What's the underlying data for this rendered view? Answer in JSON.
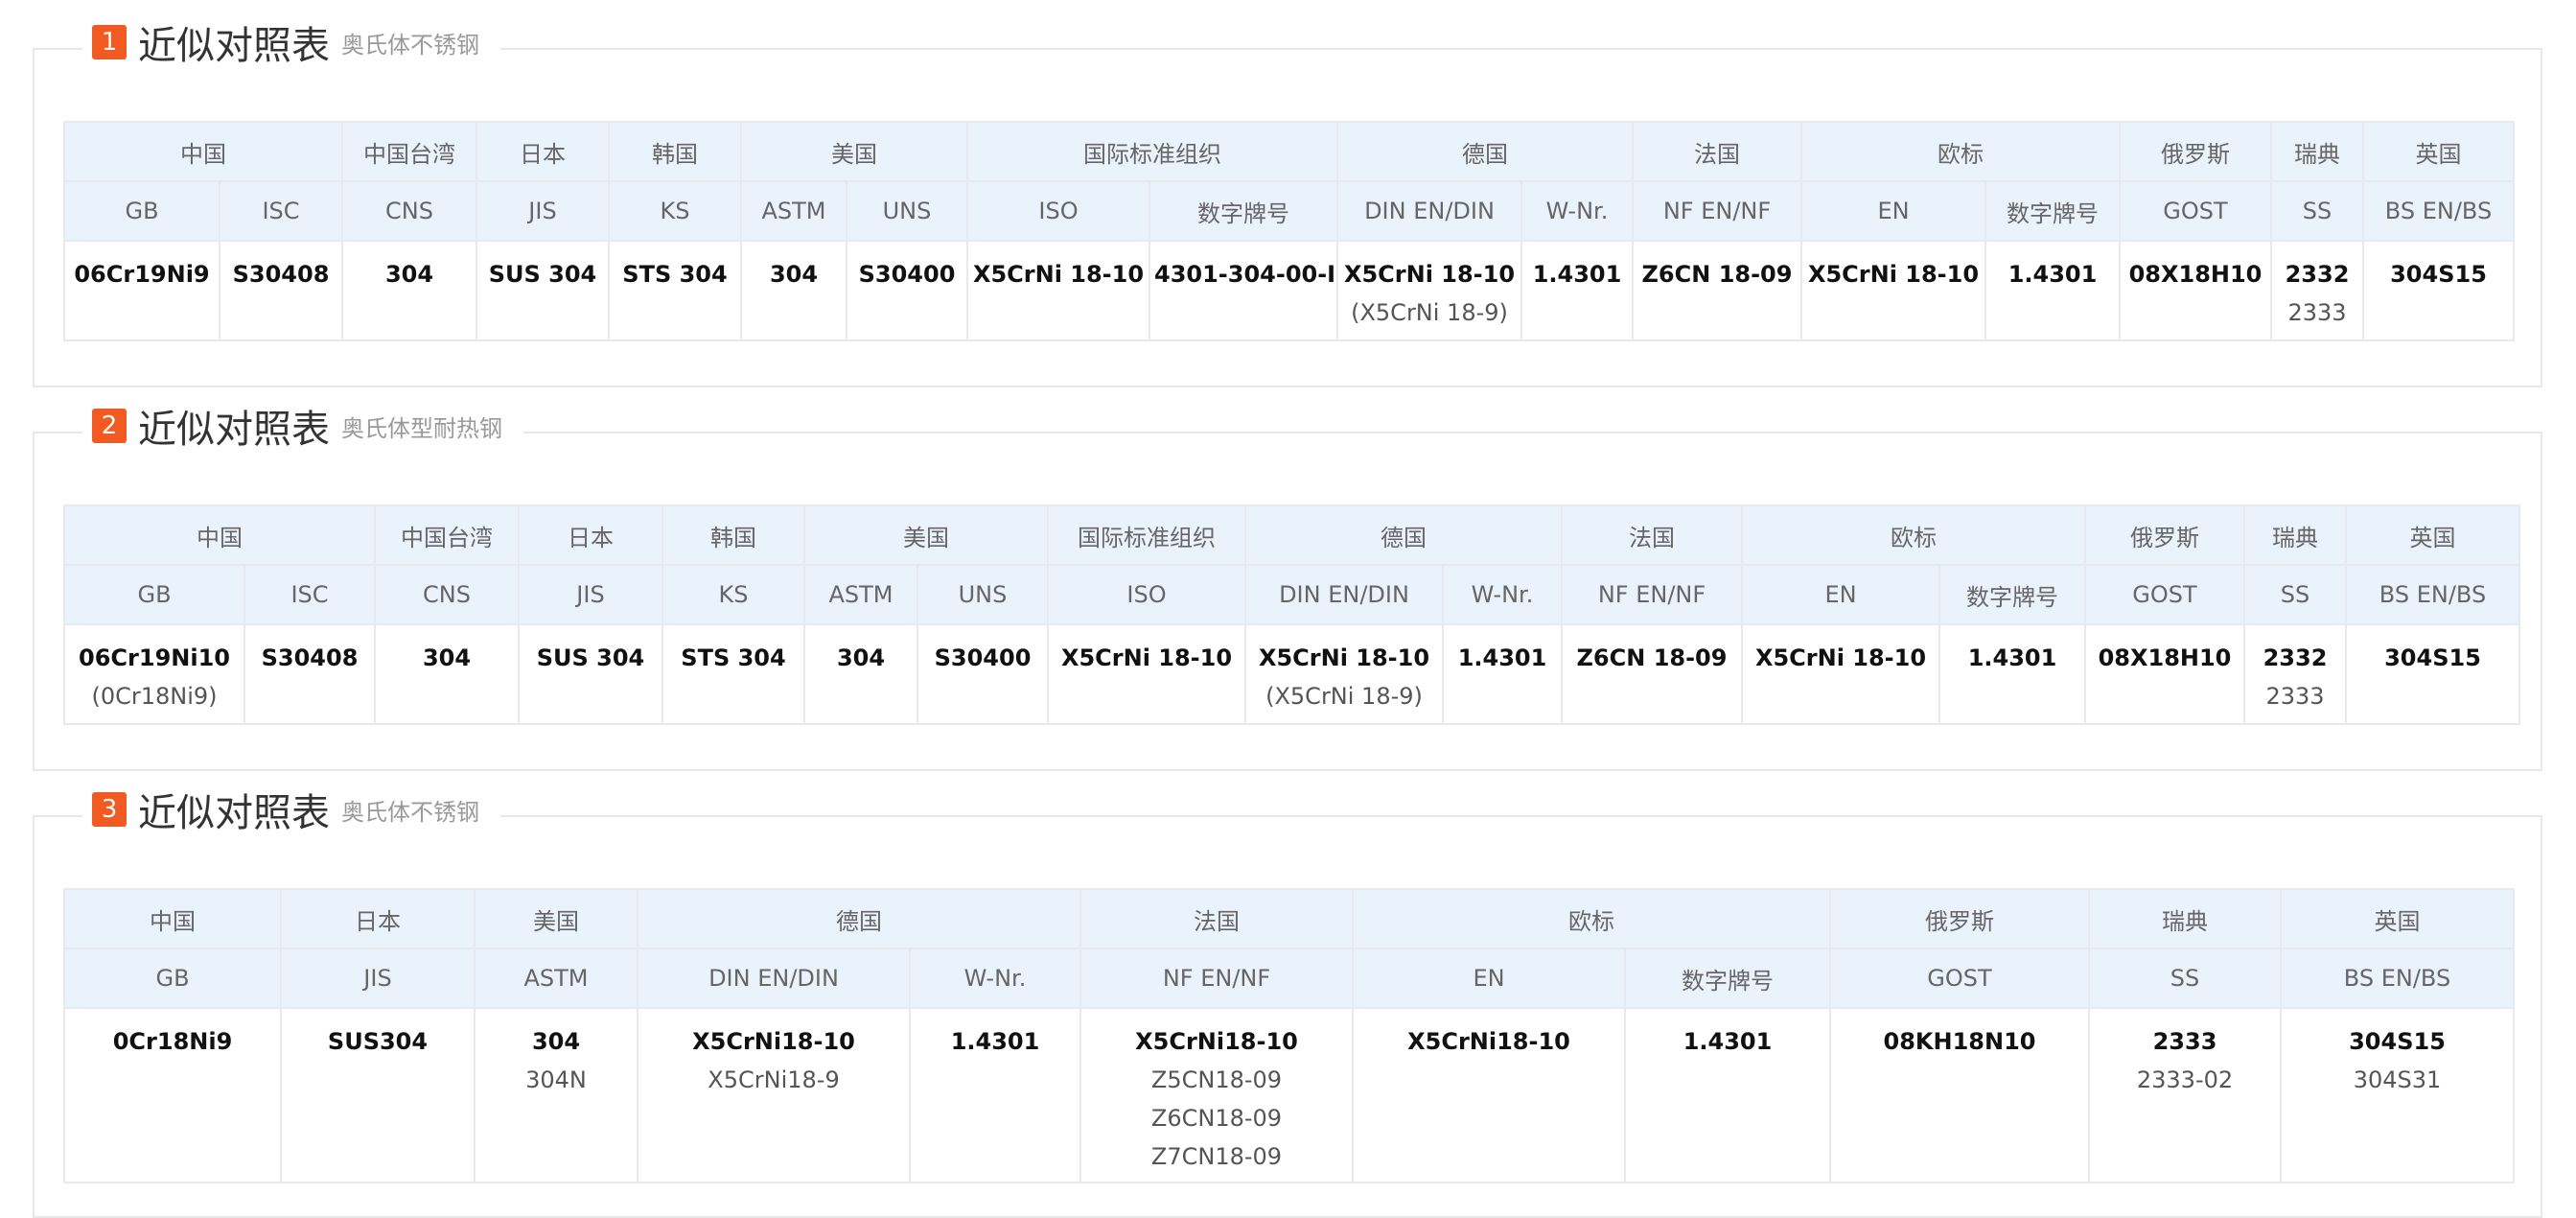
{
  "sections": [
    {
      "number": "1",
      "title": "近似对照表",
      "subtitle": "奥氏体不锈钢",
      "groups": [
        "中国",
        "中国台湾",
        "日本",
        "韩国",
        "美国",
        "国际标准组织",
        "德国",
        "法国",
        "欧标",
        "俄罗斯",
        "瑞典",
        "英国"
      ],
      "columns": [
        "GB",
        "ISC",
        "CNS",
        "JIS",
        "KS",
        "ASTM",
        "UNS",
        "ISO",
        "数字牌号",
        "DIN EN/DIN",
        "W-Nr.",
        "NF EN/NF",
        "EN",
        "数字牌号",
        "GOST",
        "SS",
        "BS EN/BS"
      ],
      "rows": [
        {
          "cells": [
            [
              "06Cr19Ni9"
            ],
            [
              "S30408"
            ],
            [
              "304"
            ],
            [
              "SUS 304"
            ],
            [
              "STS 304"
            ],
            [
              "304"
            ],
            [
              "S30400"
            ],
            [
              "X5CrNi 18-10"
            ],
            [
              "4301-304-00-I"
            ],
            [
              "X5CrNi 18-10",
              "(X5CrNi 18-9)"
            ],
            [
              "1.4301"
            ],
            [
              "Z6CN 18-09"
            ],
            [
              "X5CrNi 18-10"
            ],
            [
              "1.4301"
            ],
            [
              "08X18H10"
            ],
            [
              "2332",
              "2333"
            ],
            [
              "304S15"
            ]
          ]
        }
      ]
    },
    {
      "number": "2",
      "title": "近似对照表",
      "subtitle": "奥氏体型耐热钢",
      "groups": [
        "中国",
        "中国台湾",
        "日本",
        "韩国",
        "美国",
        "国际标准组织",
        "德国",
        "法国",
        "欧标",
        "俄罗斯",
        "瑞典",
        "英国"
      ],
      "columns": [
        "GB",
        "ISC",
        "CNS",
        "JIS",
        "KS",
        "ASTM",
        "UNS",
        "ISO",
        "DIN EN/DIN",
        "W-Nr.",
        "NF EN/NF",
        "EN",
        "数字牌号",
        "GOST",
        "SS",
        "BS EN/BS"
      ],
      "rows": [
        {
          "cells": [
            [
              "06Cr19Ni10",
              "(0Cr18Ni9)"
            ],
            [
              "S30408"
            ],
            [
              "304"
            ],
            [
              "SUS 304"
            ],
            [
              "STS 304"
            ],
            [
              "304"
            ],
            [
              "S30400"
            ],
            [
              "X5CrNi 18-10"
            ],
            [
              "X5CrNi 18-10",
              "(X5CrNi 18-9)"
            ],
            [
              "1.4301"
            ],
            [
              "Z6CN 18-09"
            ],
            [
              "X5CrNi 18-10"
            ],
            [
              "1.4301"
            ],
            [
              "08X18H10"
            ],
            [
              "2332",
              "2333"
            ],
            [
              "304S15"
            ]
          ]
        }
      ]
    },
    {
      "number": "3",
      "title": "近似对照表",
      "subtitle": "奥氏体不锈钢",
      "groups": [
        "中国",
        "日本",
        "美国",
        "德国",
        "法国",
        "欧标",
        "俄罗斯",
        "瑞典",
        "英国"
      ],
      "columns": [
        "GB",
        "JIS",
        "ASTM",
        "DIN EN/DIN",
        "W-Nr.",
        "NF EN/NF",
        "EN",
        "数字牌号",
        "GOST",
        "SS",
        "BS EN/BS"
      ],
      "rows": [
        {
          "cells": [
            [
              "0Cr18Ni9"
            ],
            [
              "SUS304"
            ],
            [
              "304",
              "304N"
            ],
            [
              "X5CrNi18-10",
              "X5CrNi18-9"
            ],
            [
              "1.4301"
            ],
            [
              "X5CrNi18-10",
              "Z5CN18-09",
              "Z6CN18-09",
              "Z7CN18-09"
            ],
            [
              "X5CrNi18-10"
            ],
            [
              "1.4301"
            ],
            [
              "08KH18N10"
            ],
            [
              "2333",
              "2333-02"
            ],
            [
              "304S15",
              "304S31"
            ]
          ]
        }
      ]
    }
  ]
}
